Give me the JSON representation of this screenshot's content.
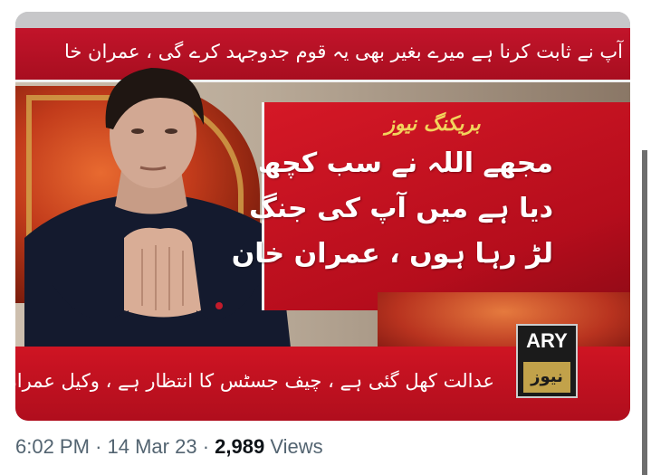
{
  "tweet": {
    "time": "6:02 PM",
    "separator": "·",
    "date": "14 Mar 23",
    "views_count": "2,989",
    "views_label": "Views"
  },
  "broadcast": {
    "top_ticker": "آپ نے ثابت کرنا ہے میرے بغیر بھی یہ قوم جدوجہد کرے گی ، عمران خا",
    "breaking_tag": "بریکنگ نیوز",
    "headline_lines": [
      "مجھے اللہ نے سب کچھ",
      "دیا ہے میں آپ کی جنگ",
      "لڑ رہا ہوں ، عمران خان"
    ],
    "bottom_ticker": "عدالت کھل گئی ہے ، چیف جسٹس کا انتظار ہے ، وکیل عمران خان نعیم",
    "logo_text": "ARY",
    "logo_sub": "نیوز"
  }
}
